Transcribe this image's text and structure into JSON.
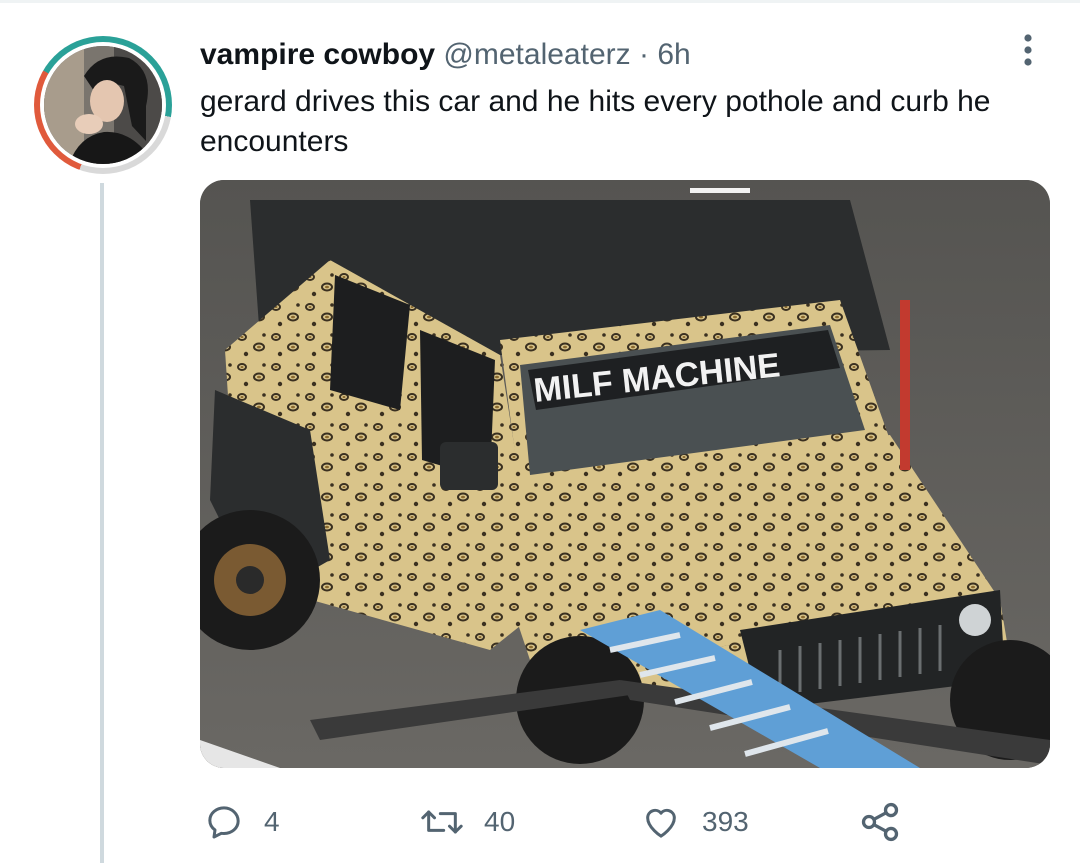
{
  "tweet": {
    "author_name": "vampire cowboy",
    "author_handle": "@metaleaterz",
    "separator": "·",
    "time": "6h",
    "text": "gerard drives this car and he hits every pothole and curb he encounters"
  },
  "media": {
    "windshield_banner_text": "MILF MACHINE"
  },
  "actions": {
    "replies": "4",
    "retweets": "40",
    "likes": "393"
  },
  "icons": {
    "more": "more-vertical-icon",
    "reply": "reply-bubble-icon",
    "retweet": "retweet-arrows-icon",
    "like": "heart-icon",
    "share": "share-icon"
  },
  "colors": {
    "text_primary": "#0f1419",
    "text_secondary": "#536471",
    "thread_line": "#cfd9de",
    "leopard_base": "#d9c48a",
    "ladder_blue": "#5f9fd6"
  }
}
